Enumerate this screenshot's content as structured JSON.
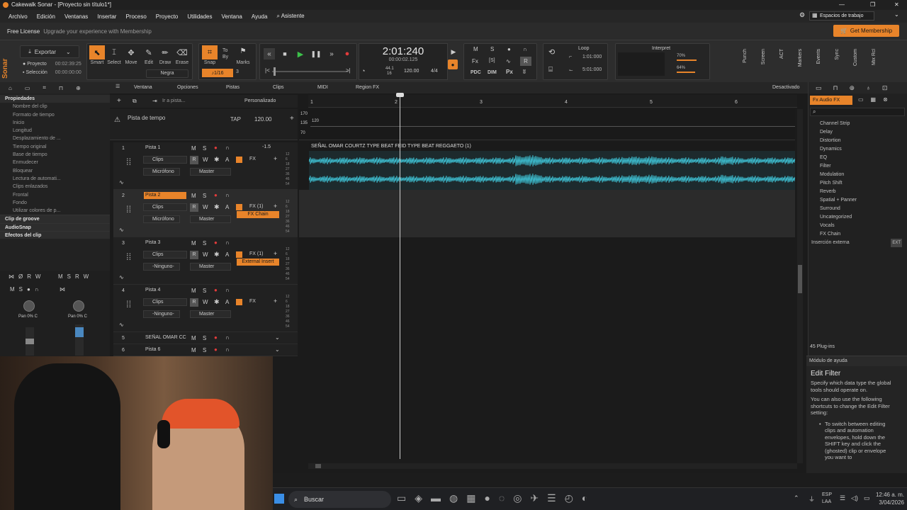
{
  "window": {
    "title": "Cakewalk Sonar - [Proyecto sin título1*]"
  },
  "menu": [
    "Archivo",
    "Edición",
    "Ventanas",
    "Insertar",
    "Proceso",
    "Proyecto",
    "Utilidades",
    "Ventana",
    "Ayuda",
    "Asistente"
  ],
  "workspace": "Espacios de trabajo",
  "license": {
    "label": "Free License",
    "text": "Upgrade your experience with Membership",
    "cta": "Get Membership"
  },
  "export": {
    "label": "Exportar",
    "project_label": "Proyecto",
    "project_time": "00:02:39:25",
    "selection_label": "Selección",
    "selection_time": "00:00:00:00"
  },
  "tools": [
    "Smart",
    "Select",
    "Move",
    "Edit",
    "Draw",
    "Erase"
  ],
  "tool_value": "Negra",
  "snap": {
    "label": "Snap",
    "to": "To",
    "by": "By",
    "value": "1/16",
    "count": "3",
    "marks": "Marks"
  },
  "transport": {
    "time": "2:01:240",
    "sub": "00:00:02.125",
    "tempo_a": "44.1",
    "tempo_b": "16",
    "bpm": "120.00",
    "meter": "4/4"
  },
  "mix_letters": {
    "m": "M",
    "s": "S",
    "r": "R",
    "fx": "Fx",
    "s2": "[S]",
    "pdc": "PDC",
    "dim": "DIM",
    "px": "Px"
  },
  "loop": {
    "label": "Loop",
    "start": "1:01:000",
    "end": "5:01:000"
  },
  "interpret": {
    "label": "Interpret",
    "a": "70%",
    "b": "64%"
  },
  "side_modules": [
    "Punch",
    "Screen",
    "ACT",
    "Markers",
    "Events",
    "Sync",
    "Custom",
    "Mix Rcl"
  ],
  "inspector": {
    "heading": "Propiedades",
    "items": [
      "Nombre del clip",
      "Formato de tiempo",
      "Inicio",
      "Longitud",
      "Desplazamiento de ...",
      "Tiempo original",
      "Base de tiempo",
      "Enmudecer",
      "Bloquear",
      "Lectura de automati...",
      "Clips enlazados",
      "Frontal",
      "Fondo",
      "Utilizar colores de p..."
    ],
    "sections": [
      "Clip de groove",
      "AudioSnap",
      "Efectos del clip"
    ],
    "strip_pan_a": "Pan 0% C",
    "strip_pan_b": "Pan 0% C"
  },
  "track_toolbar": {
    "items": [
      "Ventana",
      "Opciones",
      "Pistas",
      "Clips",
      "MIDI",
      "Region FX"
    ],
    "right": "Desactivado",
    "goto": "Ir a pista...",
    "custom": "Personalizado"
  },
  "tempo_track": {
    "label": "Pista de tempo",
    "tap": "TAP",
    "bpm": "120.00",
    "scale_high": "170",
    "scale_mid": "135",
    "scale_low": "70",
    "marker": "120"
  },
  "ruler": [
    "1",
    "2",
    "3",
    "4",
    "5",
    "6"
  ],
  "tracks": [
    {
      "num": "1",
      "name": "Pista 1",
      "clips": "Clips",
      "input": "Micrófono",
      "output": "Master",
      "fx": "FX",
      "vol": "-1.5"
    },
    {
      "num": "2",
      "name": "Pista 2",
      "clips": "Clips",
      "input": "Micrófono",
      "output": "Master",
      "fx": "FX (1)",
      "fx_item": "FX Chain"
    },
    {
      "num": "3",
      "name": "Pista 3",
      "clips": "Clips",
      "input": "-Ninguno-",
      "output": "Master",
      "fx": "FX (1)",
      "fx_item": "External Insert"
    },
    {
      "num": "4",
      "name": "Pista 4",
      "clips": "Clips",
      "input": "-Ninguno-",
      "output": "Master",
      "fx": "FX"
    },
    {
      "num": "5",
      "name": "SEÑAL OMAR CC"
    },
    {
      "num": "6",
      "name": "Pista 6"
    }
  ],
  "clip": {
    "title": "SEÑAL  OMAR COURTZ TYPE BEAT  FEID TYPE BEAT  REGGAETO (1)",
    "color": "#3bb3c4"
  },
  "meter_scale": [
    "12",
    "6",
    "18",
    "27",
    "36",
    "46",
    "54"
  ],
  "browser": {
    "tab": "Audio FX",
    "plugins": [
      "Channel Strip",
      "Delay",
      "Distortion",
      "Dynamics",
      "EQ",
      "Filter",
      "Modulation",
      "Pitch Shift",
      "Reverb",
      "Spatial + Panner",
      "Surround",
      "Uncategorized",
      "Vocals",
      "FX Chain"
    ],
    "external": "Inserción externa",
    "ext_badge": "EXT",
    "count": "45 Plug-ins"
  },
  "help": {
    "title": "Módulo de ayuda",
    "heading": "Edit Filter",
    "p1": "Specify which data type the global tools should operate on.",
    "p2": "You can also use the following shortcuts to change the Edit Filter setting:",
    "bullet": "To switch between editing clips and automation envelopes, hold down the SHIFT key and click the (ghosted) clip or envelope you want to"
  },
  "taskbar": {
    "search": "Buscar",
    "lang": "ESP",
    "region": "LAA",
    "time": "12:46 a. m.",
    "date": "3/04/2026"
  },
  "colors": {
    "accent": "#e8842a",
    "waveform": "#3bb3c4",
    "bg": "#1b1b1b"
  }
}
